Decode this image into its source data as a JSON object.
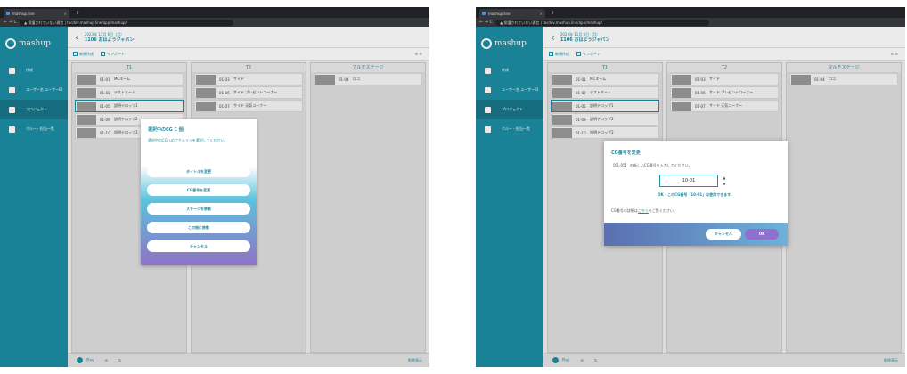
{
  "browser": {
    "tab_title": "mashup.line",
    "tab_close": "×",
    "new_tab": "+",
    "nav": "← → C",
    "url": "▲ 保護されていない通信 | tacdev.mashup.line/app/mashup/"
  },
  "app": {
    "logo": "mashup",
    "sidebar": [
      {
        "label": "作成"
      },
      {
        "label": "ユーザー名 ユーザーID"
      },
      {
        "label": "プロジェクト"
      },
      {
        "label": "クルー・担当一覧"
      }
    ],
    "header": {
      "date": "2023年 11月 6日（月）",
      "title": "1106 おはようジャパン"
    },
    "toolbar": {
      "create": "新規作成",
      "import": "インポート",
      "right": "⚙ ⚙"
    },
    "columns": [
      {
        "title": "T1",
        "rows": [
          {
            "id": "01-01",
            "name": "MCネーム"
          },
          {
            "id": "01-02",
            "name": "テストネーム"
          },
          {
            "id": "01-05",
            "name": "説明テロップ1"
          },
          {
            "id": "01-09",
            "name": "説明テロップ2"
          },
          {
            "id": "01-10",
            "name": "説明テロップ3"
          }
        ]
      },
      {
        "title": "T2",
        "rows": [
          {
            "id": "01-03",
            "name": "サイド"
          },
          {
            "id": "01-06",
            "name": "サイド プレゼントコーナー"
          },
          {
            "id": "01-07",
            "name": "サイド 天気コーナー"
          }
        ]
      },
      {
        "title": "マルチステージ",
        "rows": [
          {
            "id": "01-04",
            "name": "ロゴ"
          }
        ]
      }
    ],
    "bottom": {
      "play": "Play",
      "icon1": "⊞",
      "icon2": "⇅",
      "right": "削除表示"
    }
  },
  "popup": {
    "title": "選択中のCG 1 個",
    "desc": "選択中のCGへのアクションを選択してください。",
    "buttons": [
      "タイトルを変更",
      "CG番号を変更",
      "ステージを移動",
      "この後に移動",
      "キャンセル"
    ]
  },
  "modal": {
    "title": "CG番号を変更",
    "desc": "【01-05】 の新しいCG番号を入力してください。",
    "value": "10-01",
    "spinner": "▲ ▼",
    "ok_msg": "OK - このCG番号「10-01」は使用できます。",
    "note_pre": "CG番号の詳細は",
    "note_link": "こちら",
    "note_post": "をご覧ください。",
    "cancel": "キャンセル",
    "ok": "OK"
  },
  "colors": {
    "accent": "#1d8ea3",
    "sidebar": "#1d8ea3"
  }
}
